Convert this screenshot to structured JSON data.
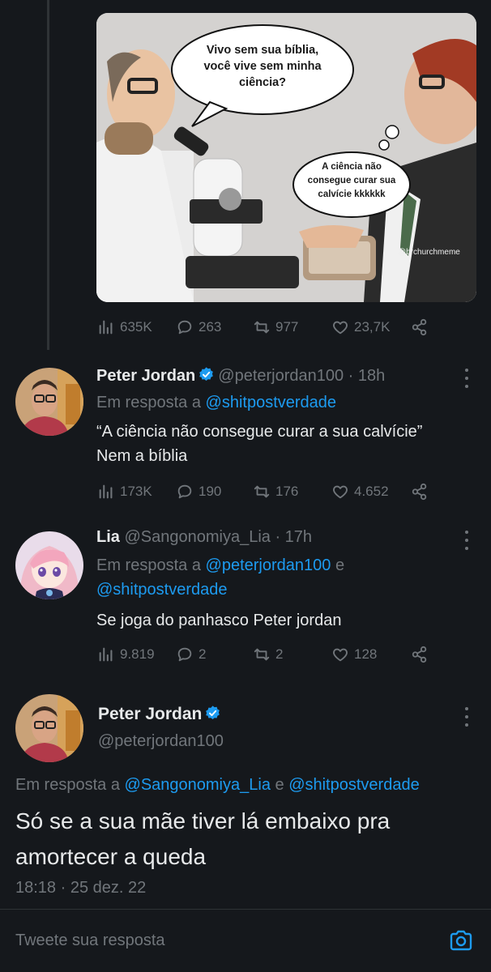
{
  "first_tweet": {
    "image": {
      "bubble_main": [
        "Vivo sem sua bíblia,",
        "você vive sem minha",
        "ciência?"
      ],
      "bubble_thought": [
        "A ciência não",
        "consegue curar sua",
        "calvície kkkkkk"
      ],
      "watermark": "@brchurchmeme"
    },
    "stats": {
      "views": "635K",
      "replies": "263",
      "retweets": "977",
      "likes": "23,7K"
    }
  },
  "reply1": {
    "name": "Peter Jordan",
    "handle": "@peterjordan100",
    "time": "18h",
    "reply_prefix": "Em resposta a",
    "reply_to": "@shitpostverdade",
    "text_lines": [
      "“A ciência não consegue curar a sua calvície”",
      "Nem a bíblia"
    ],
    "stats": {
      "views": "173K",
      "replies": "190",
      "retweets": "176",
      "likes": "4.652"
    }
  },
  "reply2": {
    "name": "Lia",
    "handle": "@Sangonomiya_Lia",
    "time": "17h",
    "reply_prefix": "Em resposta a",
    "reply_to_1": "@peterjordan100",
    "reply_conj": "e",
    "reply_to_2": "@shitpostverdade",
    "text": "Se joga do panhasco Peter jordan",
    "stats": {
      "views": "9.819",
      "replies": "2",
      "retweets": "2",
      "likes": "128"
    }
  },
  "main_tweet": {
    "name": "Peter Jordan",
    "handle": "@peterjordan100",
    "reply_prefix": "Em resposta a",
    "reply_to_1": "@Sangonomiya_Lia",
    "reply_conj": "e",
    "reply_to_2": "@shitpostverdade",
    "text": "Só se a sua mãe tiver lá embaixo pra amortecer a queda",
    "time": "18:18",
    "date": "25 dez. 22"
  },
  "reply_bar": {
    "placeholder": "Tweete sua resposta"
  },
  "colors": {
    "background": "#15181c",
    "accent": "#1d9bf0",
    "muted": "#71767b",
    "text": "#e7e9ea"
  },
  "icons": [
    "views-icon",
    "reply-icon",
    "retweet-icon",
    "like-icon",
    "share-icon",
    "more-icon",
    "verified-icon",
    "camera-icon"
  ]
}
